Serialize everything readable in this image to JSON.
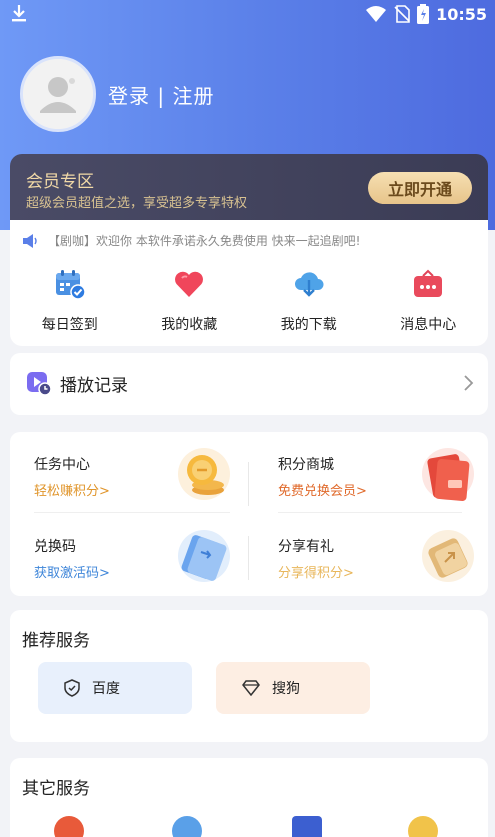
{
  "status_bar": {
    "time": "10:55",
    "icons": [
      "download-icon",
      "wifi-icon",
      "no-sim-icon",
      "battery-icon"
    ]
  },
  "profile": {
    "login_register": "登录 | 注册"
  },
  "vip": {
    "title": "会员专区",
    "subtitle": "超级会员超值之选，享受超多专享特权",
    "cta": "立即开通"
  },
  "notice": {
    "text": "【剧咖】欢迎你 本软件承诺永久免费使用 快来一起追剧吧!"
  },
  "quick_actions": [
    {
      "label": "每日签到",
      "icon": "calendar-check-icon"
    },
    {
      "label": "我的收藏",
      "icon": "heart-icon"
    },
    {
      "label": "我的下载",
      "icon": "cloud-download-icon"
    },
    {
      "label": "消息中心",
      "icon": "message-box-icon"
    }
  ],
  "play_history": {
    "label": "播放记录"
  },
  "tasks": [
    {
      "title": "任务中心",
      "subtitle": "轻松赚积分>",
      "color": "#e0952b"
    },
    {
      "title": "积分商城",
      "subtitle": "免费兑换会员>",
      "color": "#e06a2b"
    },
    {
      "title": "兑换码",
      "subtitle": "获取激活码>",
      "color": "#3f86d9"
    },
    {
      "title": "分享有礼",
      "subtitle": "分享得积分>",
      "color": "#e8b65a"
    }
  ],
  "recommended": {
    "title": "推荐服务",
    "items": [
      {
        "label": "百度"
      },
      {
        "label": "搜狗"
      }
    ]
  },
  "other": {
    "title": "其它服务"
  },
  "colors": {
    "accent": "#5a7fe8",
    "vip_gold": "#f1d9a7",
    "cta_bg": "#e7c48a"
  }
}
